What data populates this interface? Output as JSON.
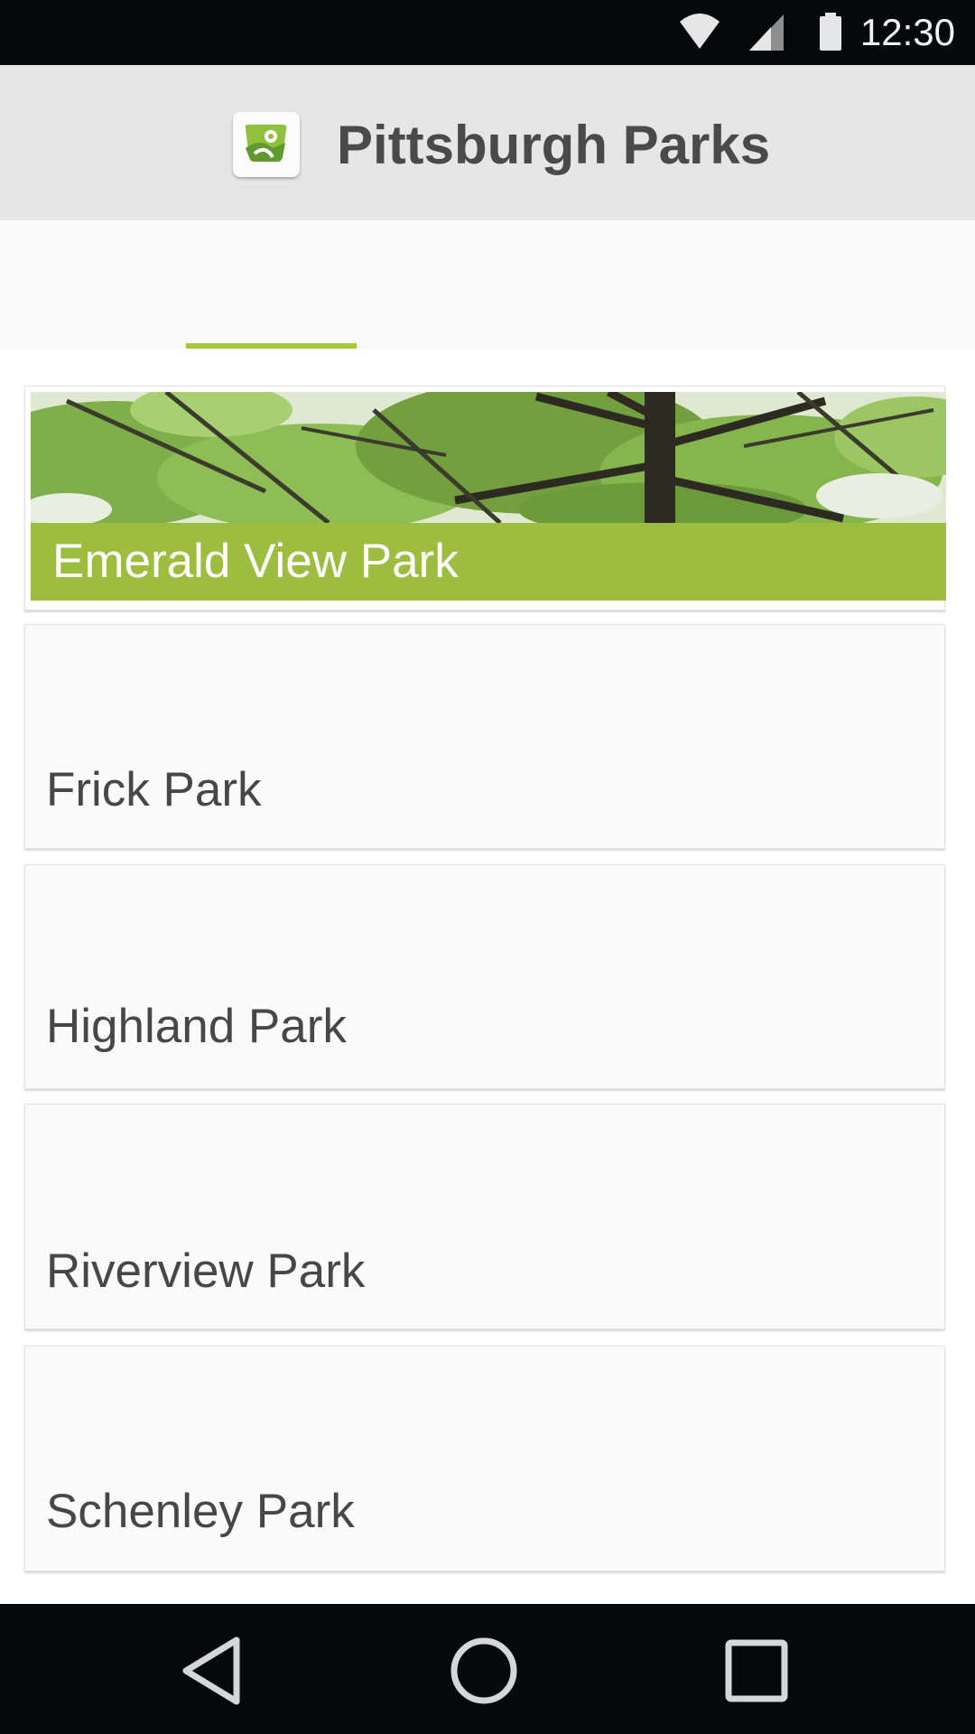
{
  "status_bar": {
    "time": "12:30",
    "icons": [
      "wifi-icon",
      "cell-signal-icon",
      "battery-icon"
    ]
  },
  "app_bar": {
    "title": "Pittsburgh Parks",
    "logo_icon": "park-photo-logo-icon"
  },
  "tabs": {
    "indicator_color": "#a4c83a"
  },
  "parks": [
    {
      "name": "Emerald View Park"
    },
    {
      "name": "Frick Park"
    },
    {
      "name": "Highland Park"
    },
    {
      "name": "Riverview Park"
    },
    {
      "name": "Schenley Park"
    }
  ],
  "nav_bar": {
    "icons": [
      "back-icon",
      "home-icon",
      "recents-icon"
    ]
  },
  "colors": {
    "accent": "#9cbd40",
    "status_bar": "#07080a",
    "app_bar": "#e6e6e6",
    "text": "#474747"
  }
}
